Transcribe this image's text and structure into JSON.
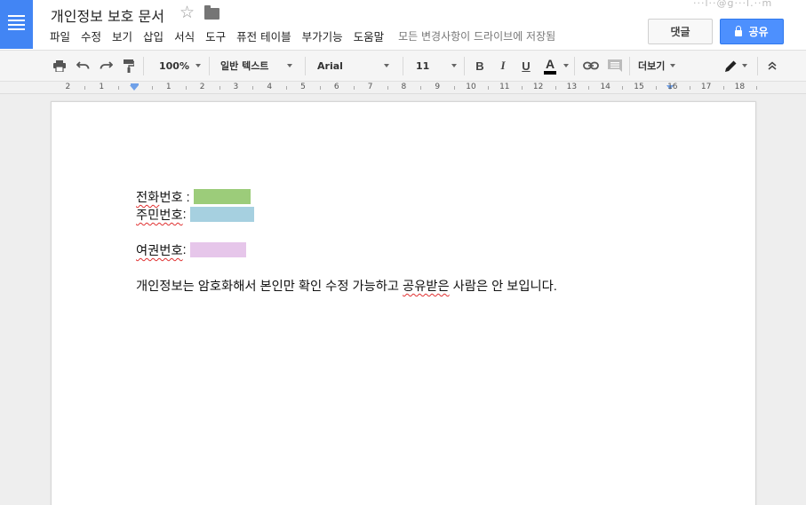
{
  "header": {
    "title": "개인정보 보호 문서",
    "account_email": "···l··@g···l.··m",
    "menu": [
      "파일",
      "수정",
      "보기",
      "삽입",
      "서식",
      "도구",
      "퓨전 테이블",
      "부가기능",
      "도움말"
    ],
    "save_status": "모든 변경사항이 드라이브에 저장됨",
    "comment_label": "댓글",
    "share_label": "공유"
  },
  "toolbar": {
    "zoom": "100%",
    "style": "일반 텍스트",
    "font": "Arial",
    "font_size": "11",
    "bold": "B",
    "italic": "I",
    "underline": "U",
    "text_color": "A",
    "more_label": "더보기"
  },
  "ruler": {
    "numbers": [
      "2",
      "1",
      "1",
      "2",
      "3",
      "4",
      "5",
      "6",
      "7",
      "8",
      "9",
      "10",
      "11",
      "12",
      "13",
      "14",
      "15",
      "16",
      "17",
      "18"
    ]
  },
  "document": {
    "phone_label_a": "전화",
    "phone_label_b": " 번호 :",
    "rrn_label_a": "주민번호",
    "rrn_label_b": " :",
    "passport_label_a": "여권번호",
    "passport_label_b": " :",
    "notice_a": "개인정보는 암호화해서 본인만 확인 수정 가능하고 ",
    "notice_b": "공유받은",
    "notice_c": " 사람은 안 보입니다.",
    "phone_block_color": "#9ccc7a",
    "rrn_block_color": "#a6d0e0",
    "passport_block_color": "#e6c6ea"
  },
  "colors": {
    "brand": "#4285f4",
    "share_button": "#4d90fe",
    "spell_error": "#e03030"
  },
  "icons": [
    "docs-menu-icon",
    "star-icon",
    "folder-icon",
    "print-icon",
    "undo-icon",
    "redo-icon",
    "paint-format-icon",
    "link-icon",
    "comment-icon",
    "pencil-icon",
    "chevron-up-icon",
    "lock-icon"
  ]
}
